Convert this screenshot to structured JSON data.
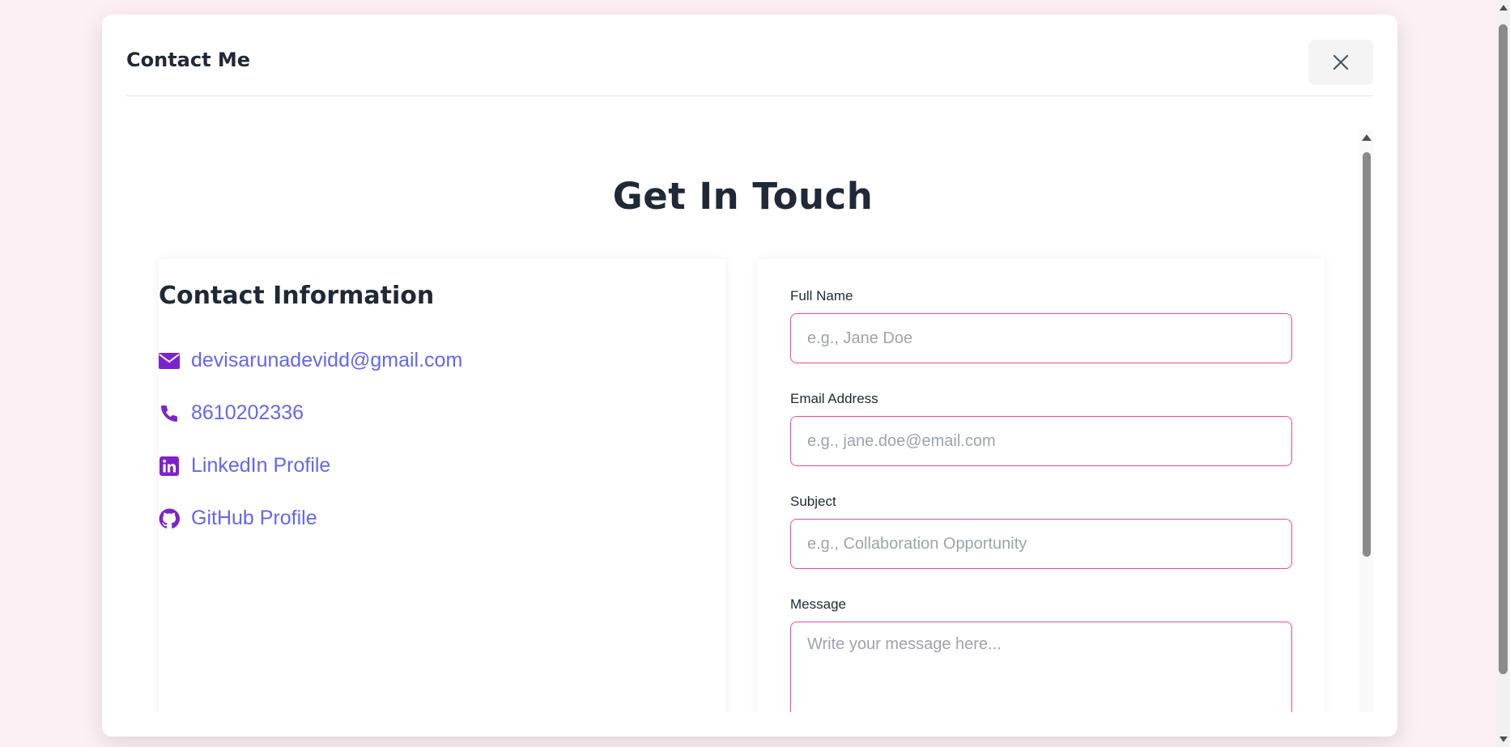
{
  "modal": {
    "title": "Contact Me",
    "close_icon": "close-icon"
  },
  "section": {
    "title": "Get In Touch"
  },
  "contact_info": {
    "title": "Contact Information",
    "items": [
      {
        "icon": "envelope-icon",
        "text": "devisarunadevidd@gmail.com"
      },
      {
        "icon": "phone-icon",
        "text": "8610202336"
      },
      {
        "icon": "linkedin-icon",
        "text": "LinkedIn Profile"
      },
      {
        "icon": "github-icon",
        "text": "GitHub Profile"
      }
    ]
  },
  "form": {
    "full_name": {
      "label": "Full Name",
      "placeholder": "e.g., Jane Doe",
      "value": ""
    },
    "email": {
      "label": "Email Address",
      "placeholder": "e.g., jane.doe@email.com",
      "value": ""
    },
    "subject": {
      "label": "Subject",
      "placeholder": "e.g., Collaboration Opportunity",
      "value": ""
    },
    "message": {
      "label": "Message",
      "placeholder": "Write your message here...",
      "value": ""
    }
  },
  "colors": {
    "page_background": "#fdf0f5",
    "icon_purple": "#7e22ce",
    "link": "#6366f1",
    "input_border": "#ec4899",
    "heading": "#1f2937"
  }
}
